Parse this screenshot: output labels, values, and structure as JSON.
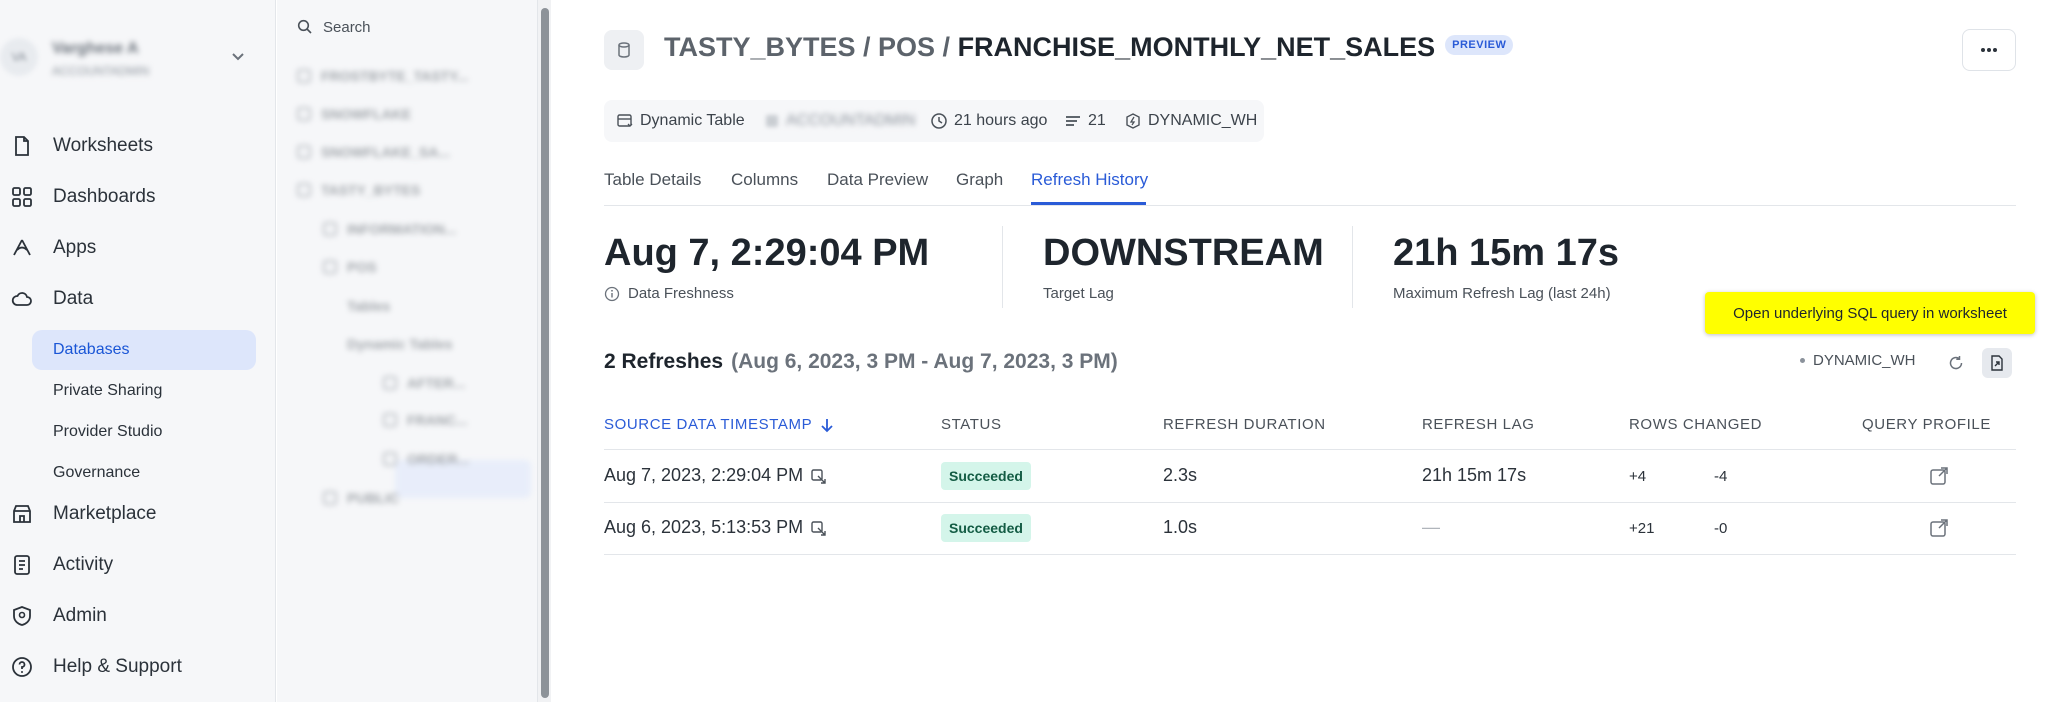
{
  "account": {
    "initials": "VA",
    "name": "Varghese A",
    "sub": "ACCOUNTADMIN"
  },
  "nav": {
    "items": [
      {
        "label": "Worksheets",
        "icon": "document-icon"
      },
      {
        "label": "Dashboards",
        "icon": "grid-icon"
      },
      {
        "label": "Apps",
        "icon": "apps-icon"
      },
      {
        "label": "Data",
        "icon": "cloud-icon"
      },
      {
        "label": "Marketplace",
        "icon": "store-icon"
      },
      {
        "label": "Activity",
        "icon": "activity-icon"
      },
      {
        "label": "Admin",
        "icon": "shield-icon"
      },
      {
        "label": "Help & Support",
        "icon": "help-icon"
      }
    ],
    "data_sub": [
      "Databases",
      "Private Sharing",
      "Provider Studio",
      "Governance"
    ]
  },
  "explorer": {
    "search_label": "Search",
    "tree": [
      "FROSTBYTE_TASTY...",
      "SNOWFLAKE",
      "SNOWFLAKE_SA...",
      "TASTY_BYTES",
      "INFORMATION...",
      "POS",
      "Tables",
      "Dynamic Tables",
      "AFTER...",
      "FRANC...",
      "ORDER...",
      "PUBLIC"
    ]
  },
  "header": {
    "path": "TASTY_BYTES / POS / ",
    "name": "FRANCHISE_MONTHLY_NET_SALES",
    "badge": "PREVIEW"
  },
  "meta": {
    "type": "Dynamic Table",
    "owner": "ACCOUNTADMIN",
    "updated": "21 hours ago",
    "rows": "21",
    "warehouse": "DYNAMIC_WH"
  },
  "tabs": [
    "Table Details",
    "Columns",
    "Data Preview",
    "Graph",
    "Refresh History"
  ],
  "active_tab": "Refresh History",
  "stats": [
    {
      "value": "Aug 7, 2:29:04 PM",
      "caption": "Data Freshness"
    },
    {
      "value": "DOWNSTREAM",
      "caption": "Target Lag"
    },
    {
      "value": "21h 15m 17s",
      "caption": "Maximum Refresh Lag (last 24h)"
    }
  ],
  "tooltip": "Open underlying SQL query in worksheet",
  "refreshes": {
    "count_label": "2 Refreshes",
    "range_label": "(Aug 6, 2023, 3 PM - Aug 7, 2023, 3 PM)",
    "warehouse": "DYNAMIC_WH"
  },
  "table": {
    "columns": [
      "SOURCE DATA TIMESTAMP",
      "STATUS",
      "REFRESH DURATION",
      "REFRESH LAG",
      "ROWS CHANGED",
      "QUERY PROFILE"
    ],
    "rows": [
      {
        "timestamp": "Aug 7, 2023, 2:29:04 PM",
        "status": "Succeeded",
        "duration": "2.3s",
        "lag": "21h 15m 17s",
        "added": "+4",
        "removed": "-4"
      },
      {
        "timestamp": "Aug 6, 2023, 5:13:53 PM",
        "status": "Succeeded",
        "duration": "1.0s",
        "lag": "—",
        "added": "+21",
        "removed": "-0"
      }
    ]
  },
  "colors": {
    "accent": "#2a5bd7",
    "success_bg": "#d4f5ea",
    "tooltip_bg": "#ffff00"
  }
}
